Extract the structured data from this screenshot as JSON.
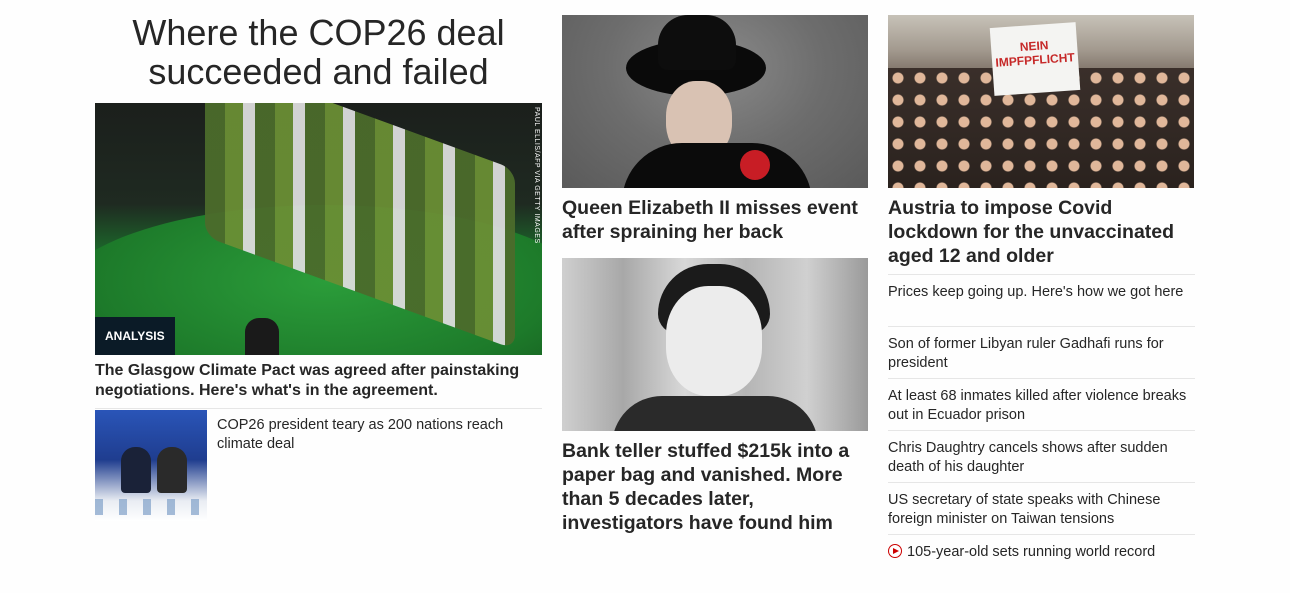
{
  "hero": {
    "title": "Where the COP26 deal succeeded and failed",
    "image_credit": "PAUL ELLIS/AFP VIA GETTY IMAGES",
    "badge": "ANALYSIS",
    "caption": "The Glasgow Climate Pact was agreed after painstaking negotiations. Here's what's in the agreement.",
    "sub_story": "COP26 president teary as 200 nations reach climate deal"
  },
  "middle": {
    "story1": "Queen Elizabeth II misses event after spraining her back",
    "story2": "Bank teller stuffed $215k into a paper bag and vanished. More than 5 decades later, investigators have found him"
  },
  "right": {
    "image_sign": "NEIN IMPFPFLICHT",
    "headline": "Austria to impose Covid lockdown for the unvaccinated aged 12 and older",
    "list": [
      "Prices keep going up. Here's how we got here",
      "Son of former Libyan ruler Gadhafi runs for president",
      "At least 68 inmates killed after violence breaks out in Ecuador prison",
      "Chris Daughtry cancels shows after sudden death of his daughter",
      "US secretary of state speaks with Chinese foreign minister on Taiwan tensions"
    ],
    "video_item": "105-year-old sets running world record"
  },
  "icons": {
    "video": "play-circle-icon"
  },
  "colors": {
    "accent": "#cc0000",
    "badge_bg": "#0b1b27",
    "text": "#262626"
  }
}
